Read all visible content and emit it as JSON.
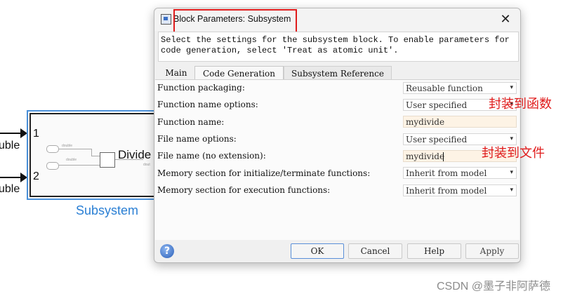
{
  "canvas": {
    "input_labels": [
      "uble",
      "uble"
    ],
    "port_numbers": [
      "1",
      "2"
    ],
    "subsystem_name": "Subsystem",
    "divide_label": "Divide",
    "mini_labels": [
      "double",
      "double",
      "dout"
    ]
  },
  "dialog": {
    "title": "Block Parameters: Subsystem",
    "close_glyph": "✕",
    "description": "Select the settings for the subsystem block. To enable parameters for code generation, select 'Treat as atomic unit'.",
    "tabs": [
      {
        "label": "Main"
      },
      {
        "label": "Code Generation",
        "active": true
      },
      {
        "label": "Subsystem Reference"
      }
    ],
    "params": [
      {
        "label": "Function packaging:",
        "value": "Reusable function",
        "kind": "select"
      },
      {
        "label": "Function name options:",
        "value": "User specified",
        "kind": "select"
      },
      {
        "label": "Function name:",
        "value": "mydivide",
        "kind": "input"
      },
      {
        "label": "File name options:",
        "value": "User specified",
        "kind": "select"
      },
      {
        "label": "File name (no extension):",
        "value": "mydivide",
        "kind": "input",
        "focused": true
      },
      {
        "label": "Memory section for initialize/terminate functions:",
        "value": "Inherit from model",
        "kind": "select"
      },
      {
        "label": "Memory section for execution functions:",
        "value": "Inherit from model",
        "kind": "select"
      }
    ],
    "annotations": [
      "封装到函数",
      "封装到文件"
    ],
    "buttons": {
      "help_icon": "?",
      "ok": "OK",
      "cancel": "Cancel",
      "help": "Help",
      "apply": "Apply"
    }
  },
  "watermark": "CSDN @墨子非阿萨德",
  "colors": {
    "annotation_red": "#e01b1b",
    "subsystem_blue": "#2a7fd4",
    "input_fill": "#fdf3e5"
  }
}
